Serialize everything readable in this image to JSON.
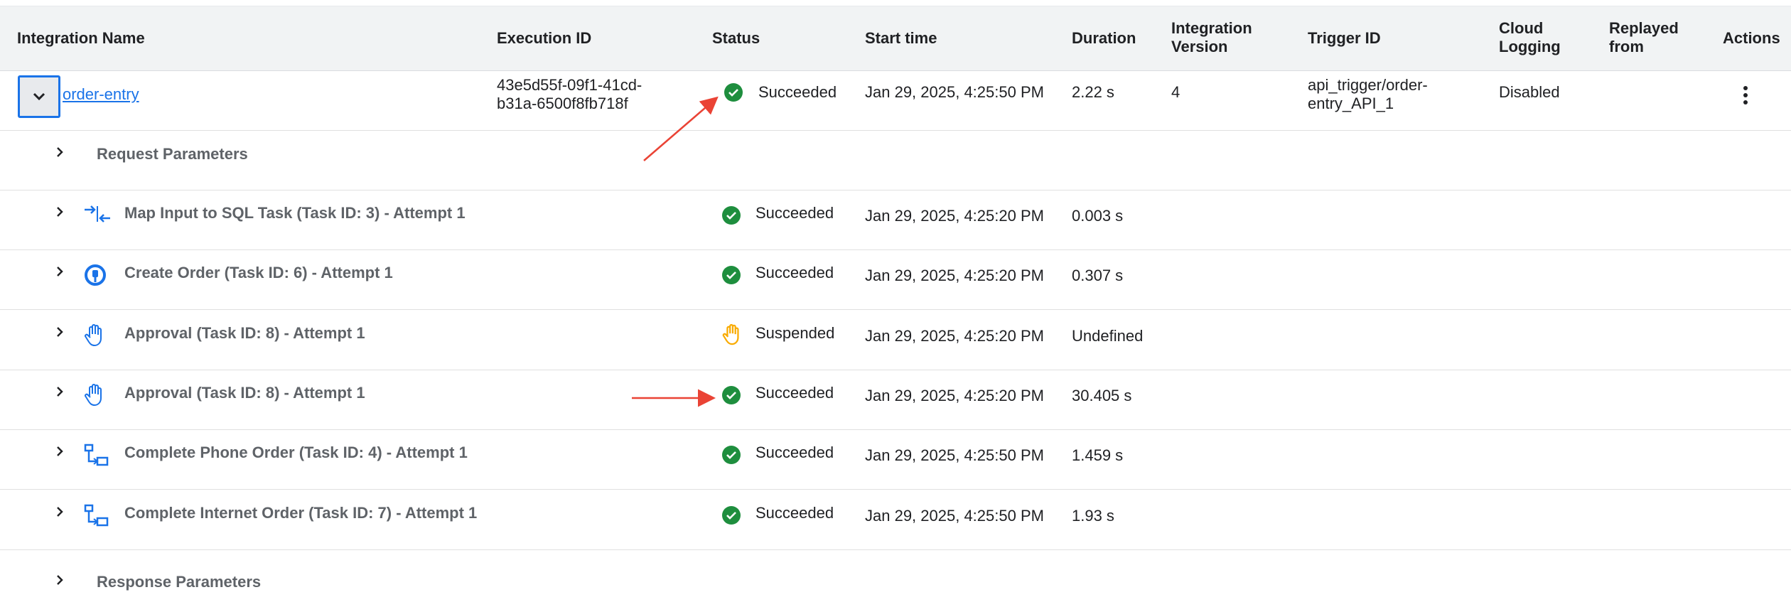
{
  "columns": {
    "integration_name": "Integration Name",
    "execution_id": "Execution ID",
    "status": "Status",
    "start_time": "Start time",
    "duration": "Duration",
    "integration_version_1": "Integration",
    "integration_version_2": "Version",
    "trigger_id": "Trigger ID",
    "cloud_logging_1": "Cloud",
    "cloud_logging_2": "Logging",
    "replayed_from_1": "Replayed",
    "replayed_from_2": "from",
    "actions": "Actions"
  },
  "execution": {
    "name": "order-entry",
    "execution_id_line1": "43e5d55f-09f1-41cd-",
    "execution_id_line2": "b31a-6500f8fb718f",
    "status": "Succeeded",
    "start_time": "Jan 29, 2025, 4:25:50 PM",
    "duration": "2.22 s",
    "version": "4",
    "trigger_id_line1": "api_trigger/order-",
    "trigger_id_line2": "entry_API_1",
    "cloud_logging": "Disabled"
  },
  "request_parameters": "Request Parameters",
  "response_parameters": "Response Parameters",
  "tasks": [
    {
      "label": "Map Input to SQL Task (Task ID: 3) - Attempt 1",
      "icon": "data-mapping-icon",
      "status": "Succeeded",
      "status_icon": "check-circle-icon",
      "start_time": "Jan 29, 2025, 4:25:20 PM",
      "duration": "0.003 s"
    },
    {
      "label": "Create Order (Task ID: 6) - Attempt 1",
      "icon": "connector-icon",
      "status": "Succeeded",
      "status_icon": "check-circle-icon",
      "start_time": "Jan 29, 2025, 4:25:20 PM",
      "duration": "0.307 s"
    },
    {
      "label": "Approval (Task ID: 8) - Attempt 1",
      "icon": "hand-icon",
      "status": "Suspended",
      "status_icon": "hand-warning-icon",
      "start_time": "Jan 29, 2025, 4:25:20 PM",
      "duration": "Undefined"
    },
    {
      "label": "Approval (Task ID: 8) - Attempt 1",
      "icon": "hand-icon",
      "status": "Succeeded",
      "status_icon": "check-circle-icon",
      "start_time": "Jan 29, 2025, 4:25:20 PM",
      "duration": "30.405 s"
    },
    {
      "label": "Complete Phone Order (Task ID: 4) - Attempt 1",
      "icon": "subflow-icon",
      "status": "Succeeded",
      "status_icon": "check-circle-icon",
      "start_time": "Jan 29, 2025, 4:25:50 PM",
      "duration": "1.459 s"
    },
    {
      "label": "Complete Internet Order (Task ID: 7) - Attempt 1",
      "icon": "subflow-icon",
      "status": "Succeeded",
      "status_icon": "check-circle-icon",
      "start_time": "Jan 29, 2025, 4:25:50 PM",
      "duration": "1.93 s"
    }
  ],
  "colors": {
    "success": "#1e8e3e",
    "warning": "#f9ab00",
    "accent": "#1a73e8",
    "annotation_arrow": "#ea4335"
  }
}
